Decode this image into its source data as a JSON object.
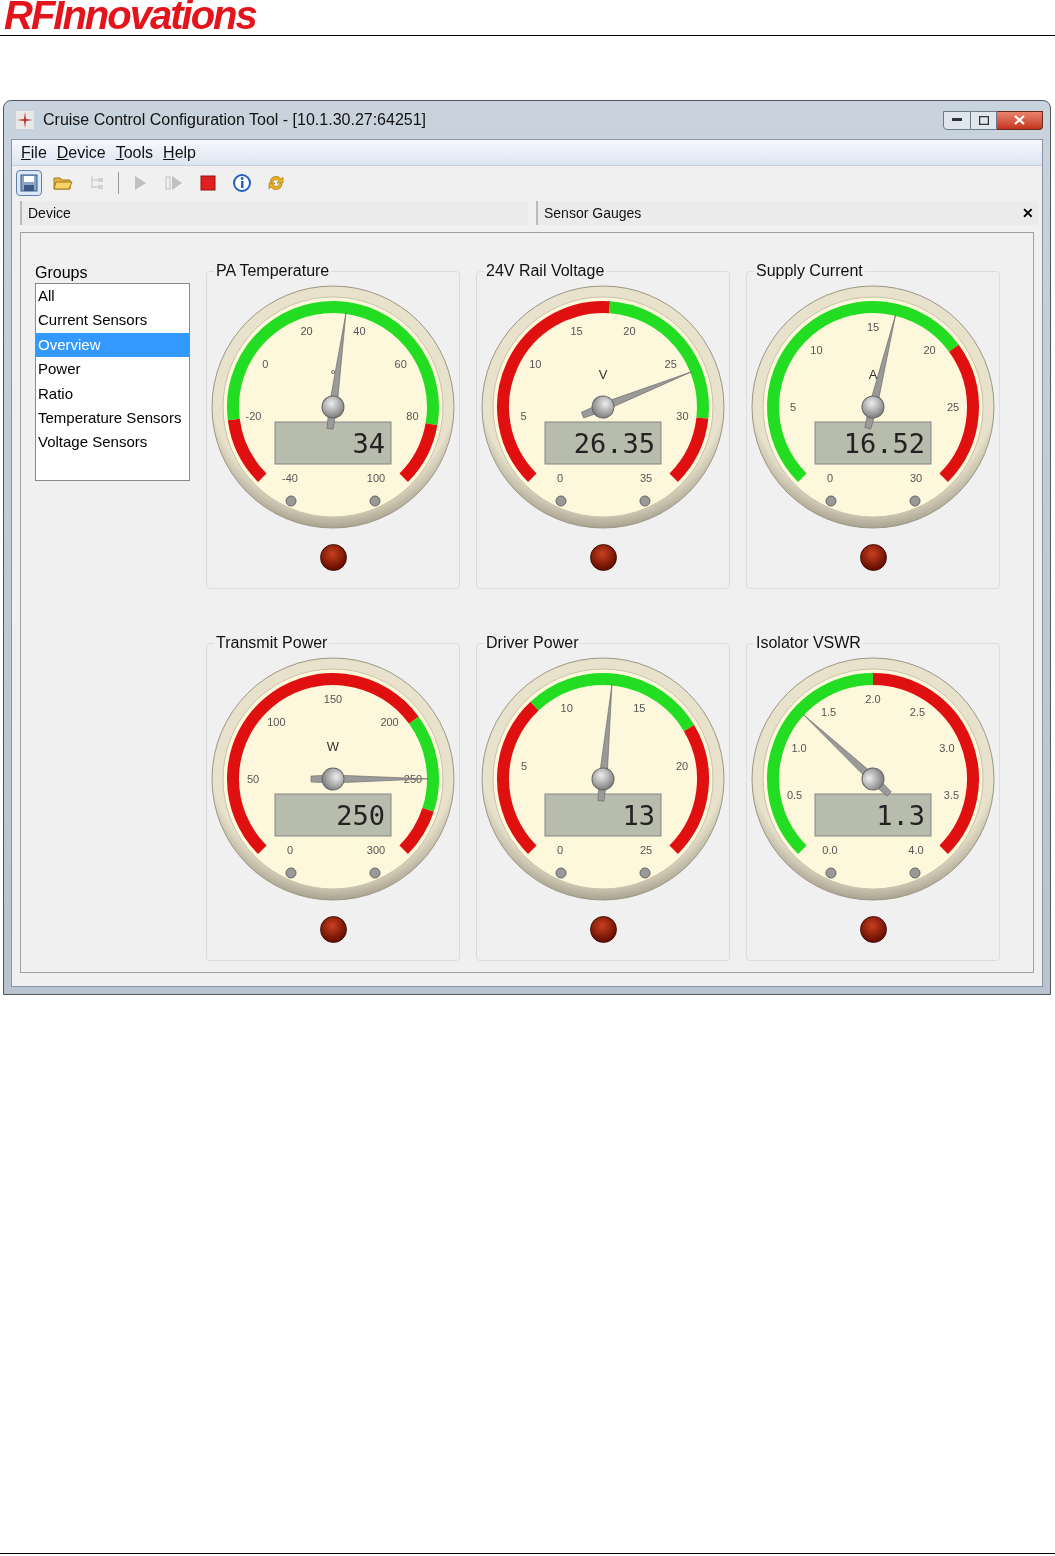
{
  "logo": "RFInnovations",
  "window": {
    "title": "Cruise Control Configuration Tool - [10.1.30.27:64251]"
  },
  "menu": [
    "File",
    "Device",
    "Tools",
    "Help"
  ],
  "toolbar": [
    {
      "kind": "save",
      "disabled": false,
      "pressed": true
    },
    {
      "kind": "open",
      "disabled": false,
      "pressed": false
    },
    {
      "kind": "tree",
      "disabled": true,
      "pressed": false
    },
    {
      "kind": "separator"
    },
    {
      "kind": "play",
      "disabled": true,
      "pressed": false
    },
    {
      "kind": "step",
      "disabled": true,
      "pressed": false
    },
    {
      "kind": "stop",
      "disabled": false,
      "pressed": false
    },
    {
      "kind": "info",
      "disabled": false,
      "pressed": false
    },
    {
      "kind": "refresh",
      "disabled": false,
      "pressed": false
    }
  ],
  "views": [
    {
      "title": "Device"
    },
    {
      "title": "Sensor Gauges",
      "close_label": "✕"
    }
  ],
  "groups": {
    "label": "Groups",
    "items": [
      {
        "label": "All",
        "selected": false
      },
      {
        "label": "Current Sensors",
        "selected": false
      },
      {
        "label": "Overview",
        "selected": true
      },
      {
        "label": "Power",
        "selected": false
      },
      {
        "label": "Ratio",
        "selected": false
      },
      {
        "label": "Temperature Sensors",
        "selected": false
      },
      {
        "label": "Voltage Sensors",
        "selected": false
      }
    ]
  },
  "gauges": [
    {
      "title": "PA Temperature",
      "unit": "°",
      "scale": [
        "-40",
        "-20",
        "0",
        "20",
        "40",
        "60",
        "80",
        "100"
      ],
      "reading": "34",
      "level": 0.529
    },
    {
      "title": "24V Rail Voltage",
      "unit": "V",
      "scale": [
        "0",
        "5",
        "10",
        "15",
        "20",
        "25",
        "30",
        "35"
      ],
      "reading": "26.35",
      "level": 0.753
    },
    {
      "title": "Supply Current",
      "unit": "A",
      "scale": [
        "0",
        "5",
        "10",
        "15",
        "20",
        "25",
        "30"
      ],
      "reading": "16.52",
      "level": 0.551
    },
    {
      "title": "Transmit Power",
      "unit": "W",
      "scale": [
        "0",
        "50",
        "100",
        "150",
        "200",
        "250",
        "300"
      ],
      "reading": "250",
      "level": 0.833
    },
    {
      "title": "Driver Power",
      "scale": [
        "0",
        "5",
        "10",
        "15",
        "20",
        "25"
      ],
      "reading": "13",
      "level": 0.52
    },
    {
      "title": "Isolator VSWR",
      "scale": [
        "0.0",
        "0.5",
        "1.0",
        "1.5",
        "2.0",
        "2.5",
        "3.0",
        "3.5",
        "4.0"
      ],
      "reading": "1.3",
      "level": 0.325
    }
  ]
}
